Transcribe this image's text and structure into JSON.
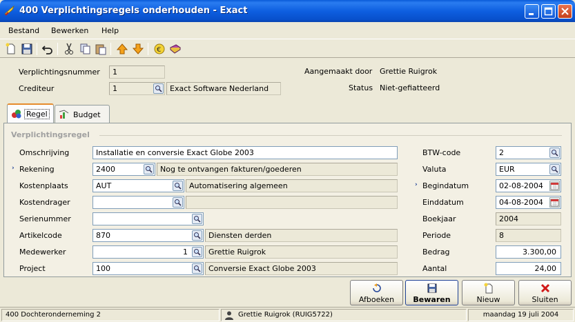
{
  "window": {
    "title": "400 Verplichtingsregels onderhouden - Exact"
  },
  "menu": {
    "items": [
      {
        "label": "Bestand"
      },
      {
        "label": "Bewerken"
      },
      {
        "label": "Help"
      }
    ]
  },
  "toolbar": {
    "icons": [
      "new-icon",
      "save-icon",
      "undo-icon",
      "cut-icon",
      "copy-icon",
      "paste-icon",
      "arrow-up-icon",
      "arrow-down-icon",
      "euro-icon",
      "book-icon"
    ]
  },
  "header": {
    "verplichtingsnummer_label": "Verplichtingsnummer",
    "verplichtingsnummer_value": "1",
    "crediteur_label": "Crediteur",
    "crediteur_code": "1",
    "crediteur_name": "Exact Software Nederland",
    "aangemaakt_label": "Aangemaakt door",
    "aangemaakt_value": "Grettie Ruigrok",
    "status_label": "Status",
    "status_value": "Niet-gefiatteerd"
  },
  "tabs": [
    {
      "label": "Regel"
    },
    {
      "label": "Budget"
    }
  ],
  "regel": {
    "group_title": "Verplichtingsregel",
    "omschrijving_label": "Omschrijving",
    "omschrijving_value": "Installatie en conversie Exact Globe 2003",
    "rekening_label": "Rekening",
    "rekening_code": "2400",
    "rekening_name": "Nog te ontvangen fakturen/goederen",
    "kostenplaats_label": "Kostenplaats",
    "kostenplaats_code": "AUT",
    "kostenplaats_name": "Automatisering algemeen",
    "kostendrager_label": "Kostendrager",
    "kostendrager_code": "",
    "kostendrager_name": "",
    "serienummer_label": "Serienummer",
    "serienummer_value": "",
    "artikelcode_label": "Artikelcode",
    "artikelcode_code": "870",
    "artikelcode_name": "Diensten derden",
    "medewerker_label": "Medewerker",
    "medewerker_code": "1",
    "medewerker_name": "Grettie Ruigrok",
    "project_label": "Project",
    "project_code": "100",
    "project_name": "Conversie Exact Globe 2003",
    "btw_label": "BTW-code",
    "btw_value": "2",
    "valuta_label": "Valuta",
    "valuta_value": "EUR",
    "begindatum_label": "Begindatum",
    "begindatum_value": "02-08-2004",
    "einddatum_label": "Einddatum",
    "einddatum_value": "04-08-2004",
    "boekjaar_label": "Boekjaar",
    "boekjaar_value": "2004",
    "periode_label": "Periode",
    "periode_value": "8",
    "bedrag_label": "Bedrag",
    "bedrag_value": "3.300,00",
    "aantal_label": "Aantal",
    "aantal_value": "24,00",
    "required_marker": "›"
  },
  "buttons": {
    "afboeken": "Afboeken",
    "bewaren": "Bewaren",
    "nieuw": "Nieuw",
    "sluiten": "Sluiten"
  },
  "statusbar": {
    "company": "400 Dochteronderneming 2",
    "user": "Grettie Ruigrok (RUIG5722)",
    "date": "maandag 19 juli 2004"
  }
}
